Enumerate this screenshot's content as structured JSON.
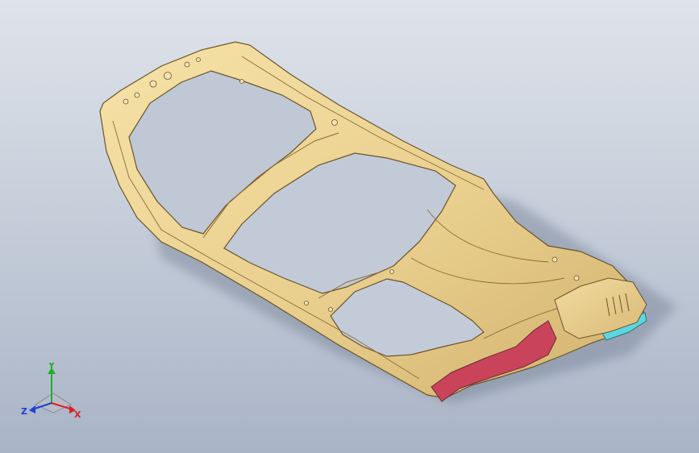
{
  "viewport": {
    "background_top": "#dfe3ea",
    "background_bottom": "#a9b4c6"
  },
  "model": {
    "part_color": "#e9cf8e",
    "part_edge_color": "#6b5428",
    "part_shadow_color": "#b8995a",
    "accent_red": "#c9445a",
    "accent_cyan": "#5ed6e0"
  },
  "triad": {
    "x_label": "X",
    "y_label": "Y",
    "z_label": "Z",
    "x_color": "#e02020",
    "y_color": "#1fae2a",
    "z_color": "#1f3fd8"
  }
}
